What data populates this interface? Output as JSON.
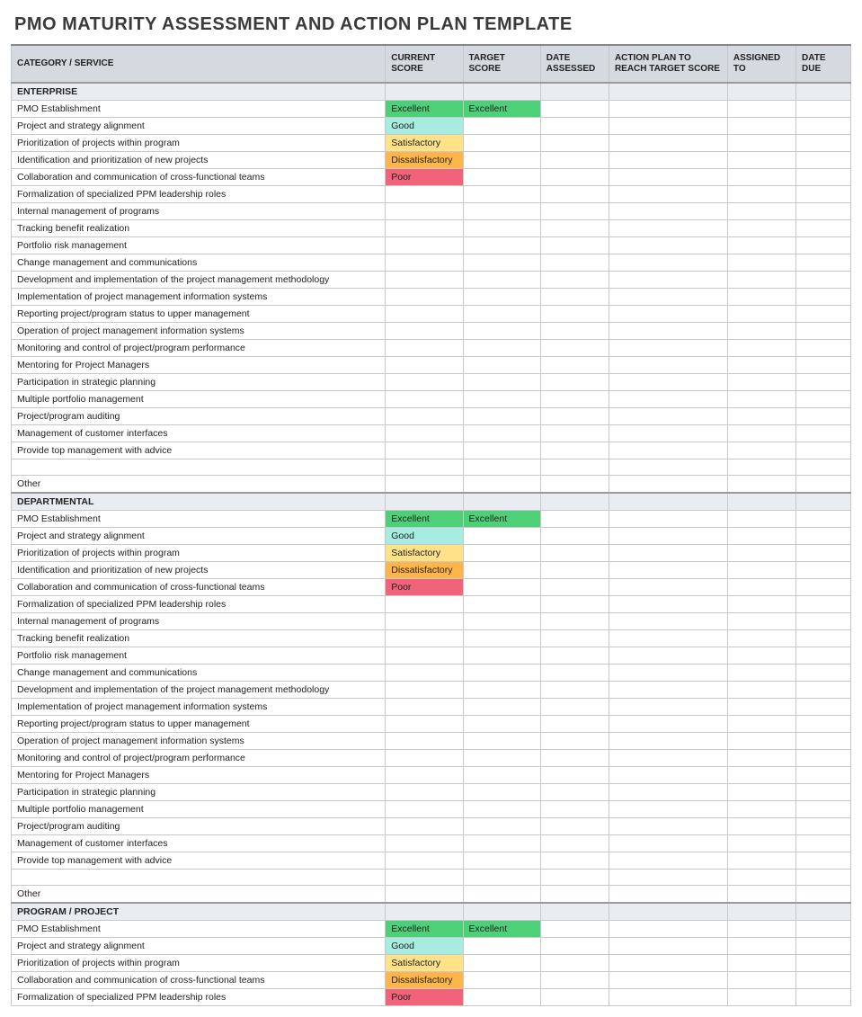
{
  "title": "PMO MATURITY ASSESSMENT AND ACTION PLAN TEMPLATE",
  "columns": [
    "CATEGORY / SERVICE",
    "CURRENT SCORE",
    "TARGET SCORE",
    "DATE ASSESSED",
    "ACTION PLAN TO REACH TARGET SCORE",
    "ASSIGNED TO",
    "DATE DUE"
  ],
  "score_colors": {
    "Excellent": "sc-excellent",
    "Good": "sc-good",
    "Satisfactory": "sc-satisfactory",
    "Dissatisfactory": "sc-dissatisfactory",
    "Poor": "sc-poor"
  },
  "sections": [
    {
      "name": "ENTERPRISE",
      "rows": [
        {
          "label": "PMO Establishment",
          "current": "Excellent",
          "target": "Excellent"
        },
        {
          "label": "Project and strategy alignment",
          "current": "Good",
          "target": ""
        },
        {
          "label": "Prioritization of projects within program",
          "current": "Satisfactory",
          "target": ""
        },
        {
          "label": "Identification and prioritization of new projects",
          "current": "Dissatisfactory",
          "target": ""
        },
        {
          "label": "Collaboration and communication of cross-functional teams",
          "current": "Poor",
          "target": ""
        },
        {
          "label": "Formalization of specialized PPM leadership roles",
          "current": "",
          "target": ""
        },
        {
          "label": "Internal management of programs",
          "current": "",
          "target": ""
        },
        {
          "label": "Tracking benefit realization",
          "current": "",
          "target": ""
        },
        {
          "label": "Portfolio risk management",
          "current": "",
          "target": ""
        },
        {
          "label": "Change management and communications",
          "current": "",
          "target": ""
        },
        {
          "label": "Development and implementation of the project management methodology",
          "current": "",
          "target": ""
        },
        {
          "label": "Implementation of project management information systems",
          "current": "",
          "target": ""
        },
        {
          "label": "Reporting project/program status to upper management",
          "current": "",
          "target": ""
        },
        {
          "label": "Operation of project management information systems",
          "current": "",
          "target": ""
        },
        {
          "label": "Monitoring and control of project/program performance",
          "current": "",
          "target": ""
        },
        {
          "label": "Mentoring for Project Managers",
          "current": "",
          "target": ""
        },
        {
          "label": "Participation in strategic planning",
          "current": "",
          "target": ""
        },
        {
          "label": "Multiple portfolio management",
          "current": "",
          "target": ""
        },
        {
          "label": "Project/program auditing",
          "current": "",
          "target": ""
        },
        {
          "label": "Management of customer interfaces",
          "current": "",
          "target": ""
        },
        {
          "label": "Provide top management with advice",
          "current": "",
          "target": ""
        },
        {
          "label": "",
          "current": "",
          "target": ""
        },
        {
          "label": "Other",
          "current": "",
          "target": ""
        }
      ]
    },
    {
      "name": "DEPARTMENTAL",
      "rows": [
        {
          "label": "PMO Establishment",
          "current": "Excellent",
          "target": "Excellent"
        },
        {
          "label": "Project and strategy alignment",
          "current": "Good",
          "target": ""
        },
        {
          "label": "Prioritization of projects within program",
          "current": "Satisfactory",
          "target": ""
        },
        {
          "label": "Identification and prioritization of new projects",
          "current": "Dissatisfactory",
          "target": ""
        },
        {
          "label": "Collaboration and communication of cross-functional teams",
          "current": "Poor",
          "target": ""
        },
        {
          "label": "Formalization of specialized PPM leadership roles",
          "current": "",
          "target": ""
        },
        {
          "label": "Internal management of programs",
          "current": "",
          "target": ""
        },
        {
          "label": "Tracking benefit realization",
          "current": "",
          "target": ""
        },
        {
          "label": "Portfolio risk management",
          "current": "",
          "target": ""
        },
        {
          "label": "Change management and communications",
          "current": "",
          "target": ""
        },
        {
          "label": "Development and implementation of the project management methodology",
          "current": "",
          "target": ""
        },
        {
          "label": "Implementation of project management information systems",
          "current": "",
          "target": ""
        },
        {
          "label": "Reporting project/program status to upper management",
          "current": "",
          "target": ""
        },
        {
          "label": "Operation of project management information systems",
          "current": "",
          "target": ""
        },
        {
          "label": "Monitoring and control of project/program performance",
          "current": "",
          "target": ""
        },
        {
          "label": "Mentoring for Project Managers",
          "current": "",
          "target": ""
        },
        {
          "label": "Participation in strategic planning",
          "current": "",
          "target": ""
        },
        {
          "label": "Multiple portfolio management",
          "current": "",
          "target": ""
        },
        {
          "label": "Project/program auditing",
          "current": "",
          "target": ""
        },
        {
          "label": "Management of customer interfaces",
          "current": "",
          "target": ""
        },
        {
          "label": "Provide top management with advice",
          "current": "",
          "target": ""
        },
        {
          "label": "",
          "current": "",
          "target": ""
        },
        {
          "label": "Other",
          "current": "",
          "target": ""
        }
      ]
    },
    {
      "name": "PROGRAM / PROJECT",
      "rows": [
        {
          "label": "PMO Establishment",
          "current": "Excellent",
          "target": "Excellent"
        },
        {
          "label": "Project and strategy alignment",
          "current": "Good",
          "target": ""
        },
        {
          "label": "Prioritization of projects within program",
          "current": "Satisfactory",
          "target": ""
        },
        {
          "label": "Collaboration and communication of cross-functional teams",
          "current": "Dissatisfactory",
          "target": ""
        },
        {
          "label": "Formalization of specialized PPM leadership roles",
          "current": "Poor",
          "target": ""
        }
      ]
    }
  ]
}
